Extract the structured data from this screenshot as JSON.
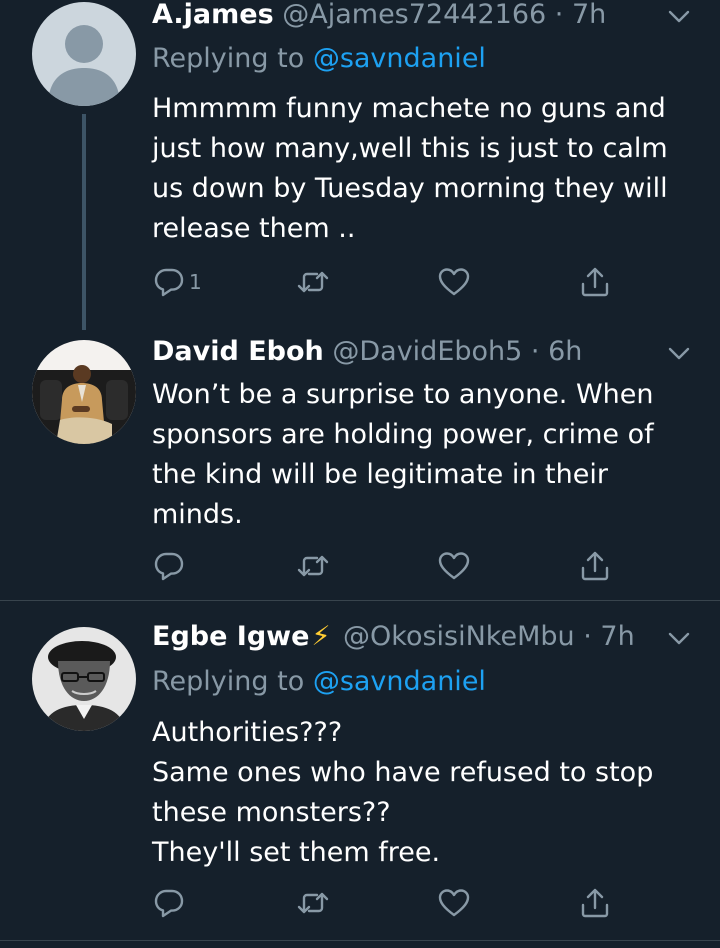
{
  "tweets": [
    {
      "name": "A.james",
      "handle": "@Ajames72442166",
      "dot": "·",
      "time": "7h",
      "replying_prefix": "Replying to ",
      "replying_to": "@savndaniel",
      "text": "Hmmmm funny machete no guns and\njust how many,well this is just to calm\nus down by Tuesday morning they will\nrelease them ..",
      "reply_count": "1"
    },
    {
      "name": "David Eboh",
      "handle": "@DavidEboh5",
      "dot": "·",
      "time": "6h",
      "text": "Won’t be a surprise to anyone. When\nsponsors are holding power, crime of\nthe kind will be legitimate in their\nminds."
    },
    {
      "name": "Egbe Igwe",
      "badge_icon": "lightning-bolt-icon",
      "handle": "@OkosisiNkeMbu",
      "dot": "·",
      "time": "7h",
      "replying_prefix": "Replying to ",
      "replying_to": "@savndaniel",
      "text": "Authorities???\nSame ones who have refused to stop\nthese monsters??\nThey'll set them free."
    }
  ],
  "colors": {
    "background": "#15202b",
    "secondary_text": "#8899a6",
    "link": "#1da1f2",
    "divider": "#38444d"
  },
  "icons": {
    "reply": "reply-icon",
    "retweet": "retweet-icon",
    "like": "heart-icon",
    "share": "share-icon",
    "more": "chevron-down-icon"
  }
}
